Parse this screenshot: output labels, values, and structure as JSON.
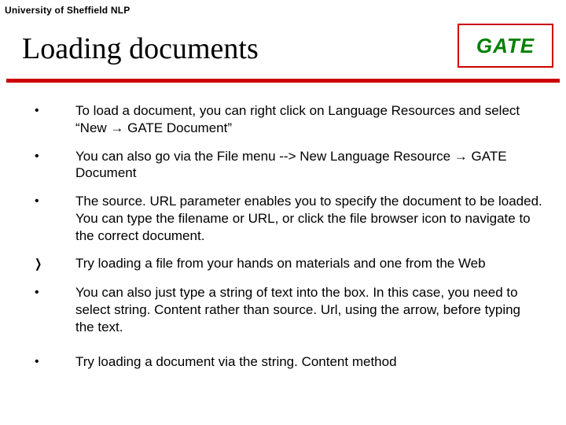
{
  "org": "University of Sheffield NLP",
  "title": "Loading documents",
  "logo": "GATE",
  "bullets": [
    {
      "kind": "dot",
      "text": "To load a document, you can right click on Language Resources and select “New → GATE Document”"
    },
    {
      "kind": "dot",
      "text": "You can also go via the File menu --> New Language Resource → GATE Document"
    },
    {
      "kind": "dot",
      "text": "The source. URL parameter enables you to specify the document to be loaded. You can type the filename or URL, or click the file browser icon to navigate to the correct document."
    },
    {
      "kind": "chevron",
      "text": "Try loading a file from your hands on materials and one from the Web"
    },
    {
      "kind": "dot",
      "text": "You can also just type a string of text into the box. In this case, you need to select string. Content rather than source. Url, using the arrow, before typing the text."
    },
    {
      "kind": "dot",
      "text": "Try loading a document via the string. Content method"
    }
  ]
}
